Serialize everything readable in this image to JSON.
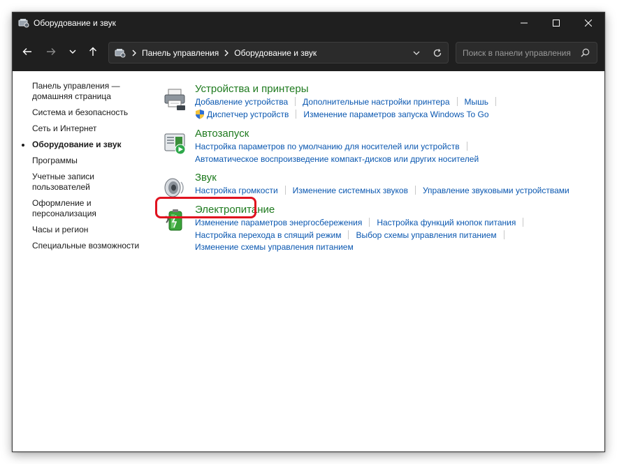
{
  "window": {
    "title": "Оборудование и звук"
  },
  "navbar": {
    "breadcrumb": [
      "Панель управления",
      "Оборудование и звук"
    ],
    "search_placeholder": "Поиск в панели управления"
  },
  "sidebar": {
    "items": [
      {
        "label": "Панель управления — домашняя страница",
        "active": false
      },
      {
        "label": "Система и безопасность",
        "active": false
      },
      {
        "label": "Сеть и Интернет",
        "active": false
      },
      {
        "label": "Оборудование и звук",
        "active": true
      },
      {
        "label": "Программы",
        "active": false
      },
      {
        "label": "Учетные записи пользователей",
        "active": false
      },
      {
        "label": "Оформление и персонализация",
        "active": false
      },
      {
        "label": "Часы и регион",
        "active": false
      },
      {
        "label": "Специальные возможности",
        "active": false
      }
    ]
  },
  "categories": [
    {
      "title": "Устройства и принтеры",
      "icon": "printer-icon",
      "links": [
        "Добавление устройства",
        "Дополнительные настройки принтера",
        "Мышь",
        "Диспетчер устройств",
        "Изменение параметров запуска Windows To Go"
      ]
    },
    {
      "title": "Автозапуск",
      "icon": "autoplay-icon",
      "links": [
        "Настройка параметров по умолчанию для носителей или устройств",
        "Автоматическое воспроизведение компакт-дисков или других носителей"
      ]
    },
    {
      "title": "Звук",
      "icon": "speaker-icon",
      "links": [
        "Настройка громкости",
        "Изменение системных звуков",
        "Управление звуковыми устройствами"
      ]
    },
    {
      "title": "Электропитание",
      "icon": "power-battery-icon",
      "highlighted": true,
      "links": [
        "Изменение параметров энергосбережения",
        "Настройка функций кнопок питания",
        "Настройка перехода в спящий режим",
        "Выбор схемы управления питанием",
        "Изменение схемы управления питанием"
      ]
    }
  ],
  "colors": {
    "titlebar": "#1f1f1f",
    "category_title": "#1e7a1e",
    "link": "#0a57b0",
    "highlight": "#e0121f"
  }
}
